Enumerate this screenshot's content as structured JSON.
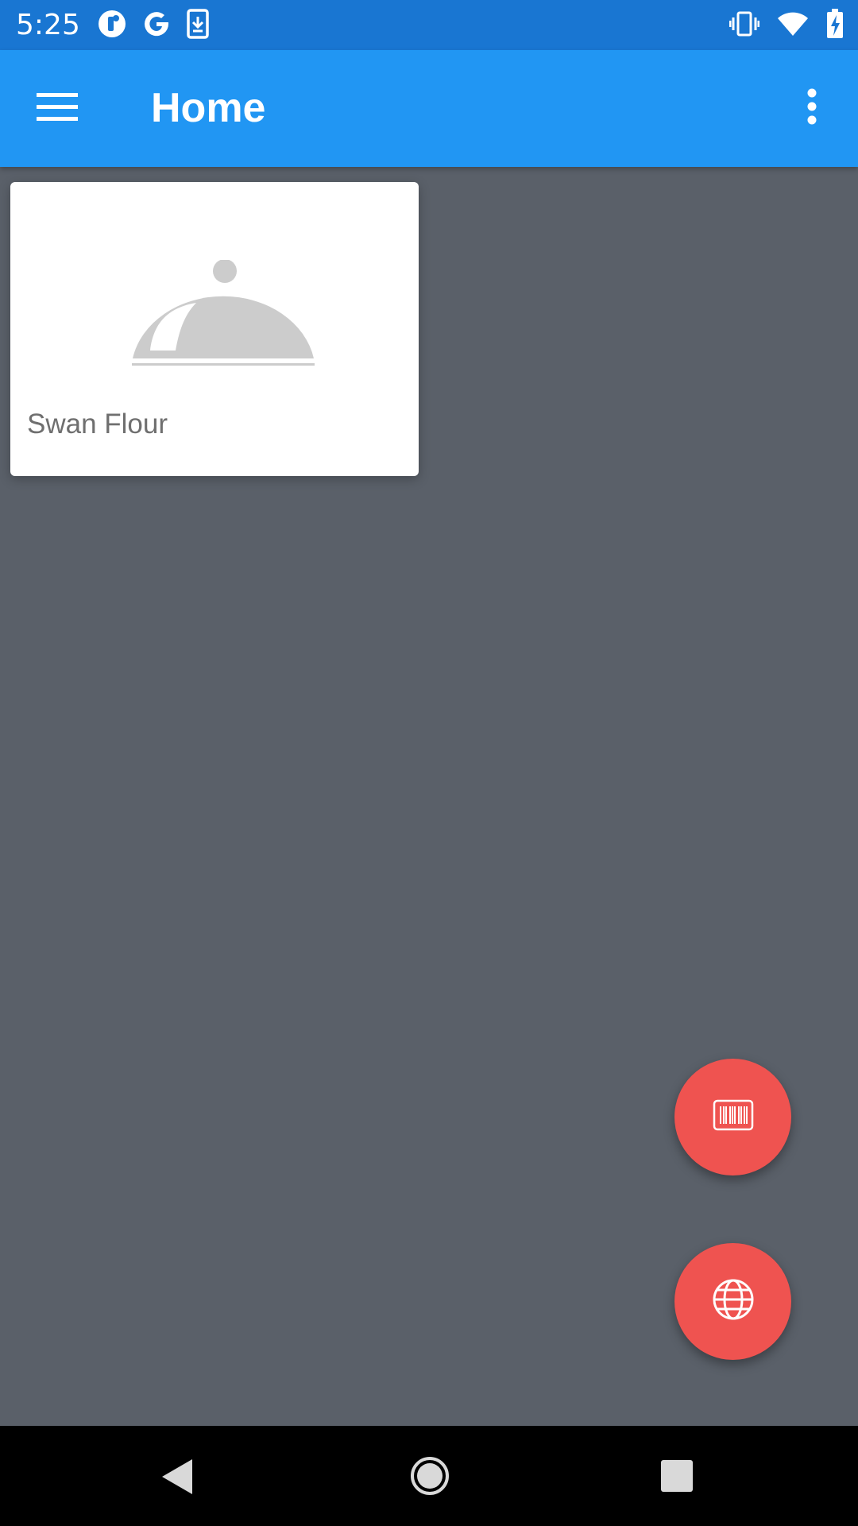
{
  "status_bar": {
    "time": "5:25",
    "left_icons": [
      "notification-app-icon",
      "google-icon",
      "download-icon"
    ],
    "right_icons": [
      "vibrate-icon",
      "wifi-icon",
      "battery-charging-icon"
    ]
  },
  "app_bar": {
    "title": "Home",
    "menu_icon": "hamburger-menu-icon",
    "overflow_icon": "more-vert-icon",
    "color": "#2196f3"
  },
  "products": [
    {
      "name": "Swan Flour",
      "image": "food-cloche-placeholder-icon"
    }
  ],
  "fabs": [
    {
      "name": "scan-barcode-button",
      "icon": "barcode-icon"
    },
    {
      "name": "web-search-button",
      "icon": "globe-icon"
    }
  ],
  "colors": {
    "status_bar": "#1976d2",
    "background": "#5a6069",
    "fab": "#ef5350",
    "placeholder": "#cccccc"
  },
  "nav_bar": {
    "buttons": [
      "back-icon",
      "home-icon",
      "recents-icon"
    ]
  }
}
